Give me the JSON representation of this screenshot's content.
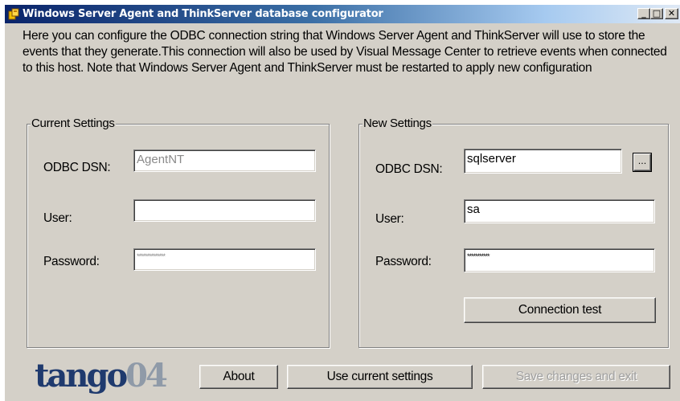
{
  "window": {
    "title": "Windows Server Agent and ThinkServer database configurator",
    "controls": {
      "minimize": "_",
      "maximize": "□",
      "close": "✕"
    }
  },
  "intro_text": "Here you can configure the ODBC connection string that Windows Server Agent and ThinkServer will use to store the events that they generate.This connection will also be used by Visual Message Center to retrieve events when connected to this host. Note that Windows Server Agent and ThinkServer must be restarted to apply new configuration",
  "current": {
    "title": "Current Settings",
    "dsn_label": "ODBC DSN:",
    "dsn_value": "AgentNT",
    "user_label": "User:",
    "user_value": "",
    "password_label": "Password:",
    "password_value": "**************"
  },
  "new": {
    "title": "New Settings",
    "dsn_label": "ODBC DSN:",
    "dsn_value": "sqlserver",
    "browse_label": "...",
    "user_label": "User:",
    "user_value": "sa",
    "password_label": "Password:",
    "password_value": "***********",
    "connection_test_label": "Connection test"
  },
  "footer": {
    "logo_part1": "tango",
    "logo_part2": "04",
    "about_label": "About",
    "use_current_label": "Use current settings",
    "save_exit_label": "Save changes and exit"
  },
  "colors": {
    "window_bg": "#d4d0c8",
    "title_start": "#0a246a",
    "title_end": "#a6caf0",
    "logo_dark": "#1f3a6e",
    "logo_light": "#8f9aa8"
  }
}
